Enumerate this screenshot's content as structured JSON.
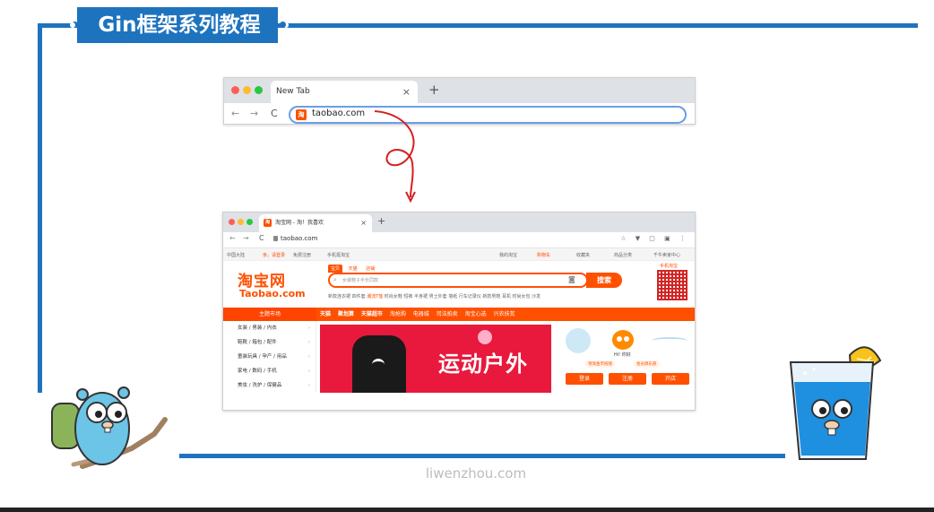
{
  "slide": {
    "title": "Gin框架系列教程",
    "footer_url": "liwenzhou.com"
  },
  "browser_before": {
    "tab_title": "New Tab",
    "tab_close": "×",
    "new_tab": "+",
    "back": "←",
    "forward": "→",
    "reload": "C",
    "site_icon_text": "淘",
    "address": "taobao.com"
  },
  "browser_after": {
    "tab_title": "淘宝网 - 淘！我喜欢",
    "tab_close": "×",
    "new_tab": "+",
    "back": "←",
    "forward": "→",
    "reload": "C",
    "site_icon_text": "淘",
    "address": "taobao.com",
    "toolbar_icons": "☆ ▼ ▢ ▣ ⋮"
  },
  "taobao": {
    "top_nav": {
      "region": "中国大陆",
      "login": "亲，请登录",
      "register": "免费注册",
      "mobile": "手机逛淘宝",
      "my_taobao": "我的淘宝",
      "cart": "购物车",
      "favorites": "收藏夹",
      "categories": "商品分类",
      "seller": "千牛卖家中心"
    },
    "logo_cn": "淘宝网",
    "logo_en": "Taobao.com",
    "search_tabs": [
      "宝贝",
      "天猫",
      "店铺"
    ],
    "search_placeholder": "女装鞋子手长同款",
    "search_button": "搜索",
    "hot_words_before": "新款连衣裙 四件套",
    "hot_words_highlight": "潮流T恤",
    "hot_words_after": "时尚女鞋 短裤 半身裙 男士外套 墙纸 行车记录仪 新款男鞋 耳机 时尚女包 沙发",
    "qr_label": "手机淘宝",
    "category_title": "主题市场",
    "category_links": [
      "天猫",
      "聚划算",
      "天猫超市",
      "淘抢购",
      "电器城",
      "司法拍卖",
      "淘宝心选",
      "兴农扶贫"
    ],
    "side_categories": [
      "女装 / 男装 / 内衣",
      "鞋靴 / 箱包 / 配件",
      "童装玩具 / 孕产 / 用品",
      "家电 / 数码 / 手机",
      "美妆 / 洗护 / 保健品"
    ],
    "banner_text": "运动户外",
    "user_panel": {
      "greeting": "Hi! 你好",
      "pill_left": "领淘金币抵钱",
      "pill_right": "会员俱乐部",
      "login_btn": "登录",
      "register_btn": "注册",
      "open_shop_btn": "开店"
    }
  },
  "colors": {
    "frame_blue": "#1e73be",
    "taobao_orange": "#ff5000",
    "banner_red": "#e8193c",
    "omnibox_blue": "#6a9ee8"
  },
  "icons": {
    "traffic_lights": [
      "#ff5f57",
      "#febc2e",
      "#28c840"
    ],
    "arrow": "curly-arrow-down",
    "mascots": [
      "gopher-hiker",
      "gopher-in-glass"
    ]
  }
}
